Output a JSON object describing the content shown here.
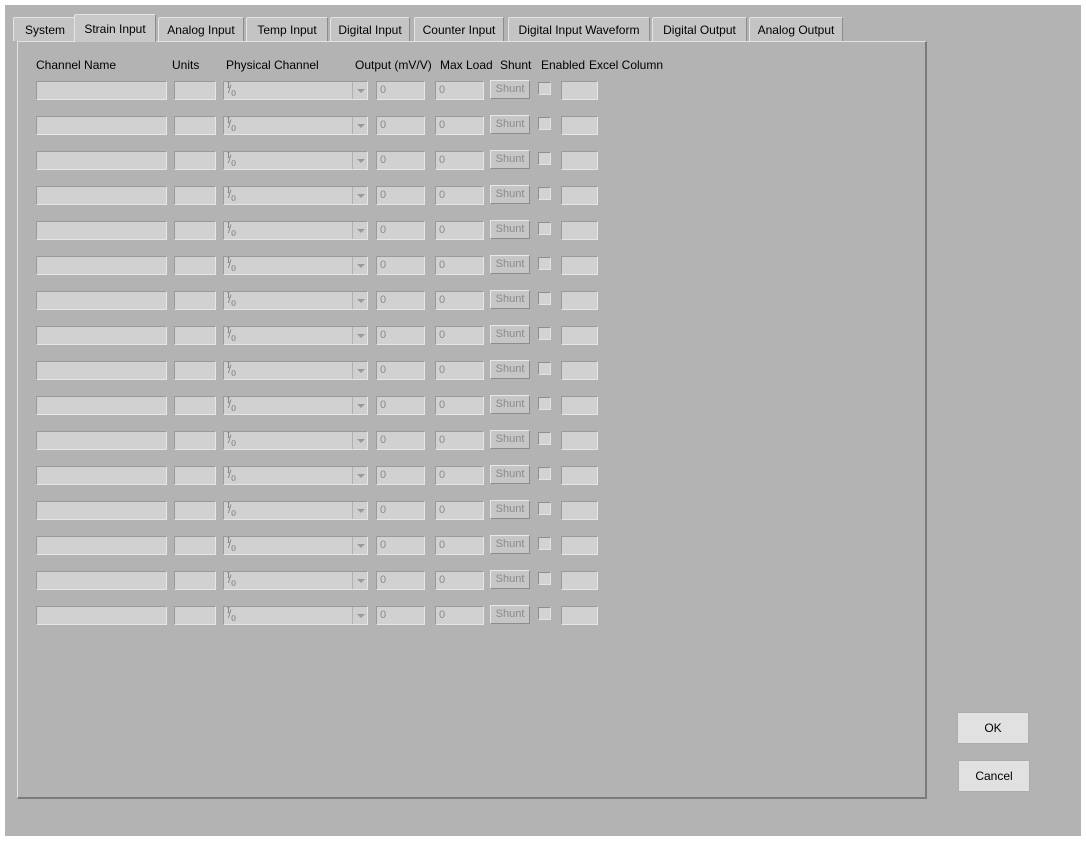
{
  "tabs": [
    {
      "label": "System",
      "active": false
    },
    {
      "label": "Strain Input",
      "active": true
    },
    {
      "label": "Analog Input",
      "active": false
    },
    {
      "label": "Temp Input",
      "active": false
    },
    {
      "label": "Digital Input",
      "active": false
    },
    {
      "label": "Counter Input",
      "active": false
    },
    {
      "label": "Digital Input Waveform",
      "active": false
    },
    {
      "label": "Digital Output",
      "active": false
    },
    {
      "label": "Analog Output",
      "active": false
    }
  ],
  "columns": {
    "channel_name": "Channel Name",
    "units": "Units",
    "physical_channel": "Physical Channel",
    "output": "Output (mV/V)",
    "max_load": "Max Load",
    "shunt": "Shunt",
    "enabled": "Enabled",
    "excel_column": "Excel Column"
  },
  "io_icon": {
    "top": "I",
    "bottom": "0",
    "name": "io-icon"
  },
  "rows": [
    {
      "channel_name": "",
      "units": "",
      "physical_channel": "",
      "output": "0",
      "max_load": "0",
      "shunt_label": "Shunt",
      "enabled": false,
      "excel_column": ""
    },
    {
      "channel_name": "",
      "units": "",
      "physical_channel": "",
      "output": "0",
      "max_load": "0",
      "shunt_label": "Shunt",
      "enabled": false,
      "excel_column": ""
    },
    {
      "channel_name": "",
      "units": "",
      "physical_channel": "",
      "output": "0",
      "max_load": "0",
      "shunt_label": "Shunt",
      "enabled": false,
      "excel_column": ""
    },
    {
      "channel_name": "",
      "units": "",
      "physical_channel": "",
      "output": "0",
      "max_load": "0",
      "shunt_label": "Shunt",
      "enabled": false,
      "excel_column": ""
    },
    {
      "channel_name": "",
      "units": "",
      "physical_channel": "",
      "output": "0",
      "max_load": "0",
      "shunt_label": "Shunt",
      "enabled": false,
      "excel_column": ""
    },
    {
      "channel_name": "",
      "units": "",
      "physical_channel": "",
      "output": "0",
      "max_load": "0",
      "shunt_label": "Shunt",
      "enabled": false,
      "excel_column": ""
    },
    {
      "channel_name": "",
      "units": "",
      "physical_channel": "",
      "output": "0",
      "max_load": "0",
      "shunt_label": "Shunt",
      "enabled": false,
      "excel_column": ""
    },
    {
      "channel_name": "",
      "units": "",
      "physical_channel": "",
      "output": "0",
      "max_load": "0",
      "shunt_label": "Shunt",
      "enabled": false,
      "excel_column": ""
    },
    {
      "channel_name": "",
      "units": "",
      "physical_channel": "",
      "output": "0",
      "max_load": "0",
      "shunt_label": "Shunt",
      "enabled": false,
      "excel_column": ""
    },
    {
      "channel_name": "",
      "units": "",
      "physical_channel": "",
      "output": "0",
      "max_load": "0",
      "shunt_label": "Shunt",
      "enabled": false,
      "excel_column": ""
    },
    {
      "channel_name": "",
      "units": "",
      "physical_channel": "",
      "output": "0",
      "max_load": "0",
      "shunt_label": "Shunt",
      "enabled": false,
      "excel_column": ""
    },
    {
      "channel_name": "",
      "units": "",
      "physical_channel": "",
      "output": "0",
      "max_load": "0",
      "shunt_label": "Shunt",
      "enabled": false,
      "excel_column": ""
    },
    {
      "channel_name": "",
      "units": "",
      "physical_channel": "",
      "output": "0",
      "max_load": "0",
      "shunt_label": "Shunt",
      "enabled": false,
      "excel_column": ""
    },
    {
      "channel_name": "",
      "units": "",
      "physical_channel": "",
      "output": "0",
      "max_load": "0",
      "shunt_label": "Shunt",
      "enabled": false,
      "excel_column": ""
    },
    {
      "channel_name": "",
      "units": "",
      "physical_channel": "",
      "output": "0",
      "max_load": "0",
      "shunt_label": "Shunt",
      "enabled": false,
      "excel_column": ""
    },
    {
      "channel_name": "",
      "units": "",
      "physical_channel": "",
      "output": "0",
      "max_load": "0",
      "shunt_label": "Shunt",
      "enabled": false,
      "excel_column": ""
    }
  ],
  "buttons": {
    "ok": "OK",
    "cancel": "Cancel"
  },
  "colors": {
    "background": "#b3b3b3",
    "field": "#d1d1d1",
    "button": "#e1e1e1"
  }
}
